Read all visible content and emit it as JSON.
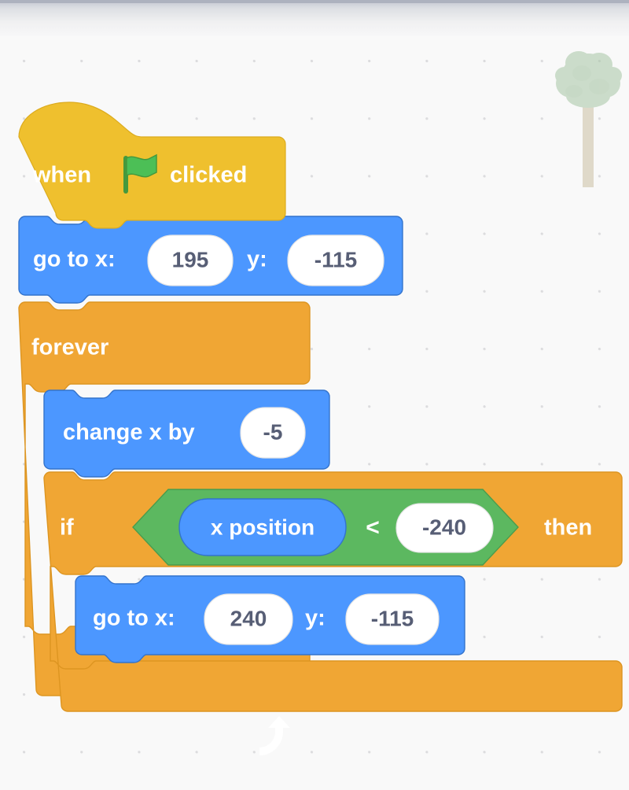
{
  "workspace": {
    "name": "scratch-code-workspace",
    "background_color": "#f9f9f9",
    "grid_dot_color": "#dcdcde",
    "top_bar_color": "#adb2bf"
  },
  "sprite_watermark": {
    "name": "tree",
    "leaf_color": "#a7c6a4",
    "trunk_color": "#cbbfa2"
  },
  "palette": {
    "events_color": "#ffbf00",
    "events_color_light": "#f0c040",
    "motion_color": "#4c97ff",
    "motion_color_stroke": "#3373cc",
    "control_color": "#f0a634",
    "control_color_stroke": "#cf8b17",
    "operators_color": "#5cb860",
    "operators_color_stroke": "#389438",
    "input_fill": "#ffffff",
    "input_text": "#575e75",
    "block_text": "#ffffff"
  },
  "script": {
    "name": "main-script",
    "blocks": [
      {
        "id": "when-flag-clicked",
        "type": "event_whenflagclicked",
        "category": "events",
        "label_before": "when",
        "icon": "green-flag-icon",
        "label_after": "clicked"
      },
      {
        "id": "go-to-xy-1",
        "type": "motion_gotoxy",
        "category": "motion",
        "label_x": "go to x:",
        "value_x": "195",
        "label_y": "y:",
        "value_y": "-115"
      },
      {
        "id": "forever-loop",
        "type": "control_forever",
        "category": "control",
        "label": "forever",
        "icon": "loop-arrow-icon",
        "children": [
          {
            "id": "change-x-by",
            "type": "motion_changexby",
            "category": "motion",
            "label": "change x by",
            "value": "-5"
          },
          {
            "id": "if-then",
            "type": "control_if",
            "category": "control",
            "label_if": "if",
            "label_then": "then",
            "condition": {
              "id": "less-than",
              "type": "operator_lt",
              "category": "operators",
              "operator": "<",
              "left": {
                "id": "x-position-reporter",
                "type": "motion_xposition",
                "category": "motion",
                "label": "x position"
              },
              "right_value": "-240"
            },
            "children": [
              {
                "id": "go-to-xy-2",
                "type": "motion_gotoxy",
                "category": "motion",
                "label_x": "go to x:",
                "value_x": "240",
                "label_y": "y:",
                "value_y": "-115"
              }
            ]
          }
        ]
      }
    ]
  }
}
